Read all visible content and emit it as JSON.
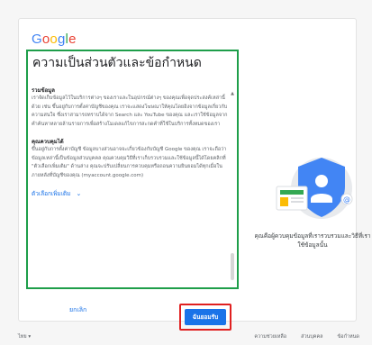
{
  "logo": {
    "letters": [
      "G",
      "o",
      "o",
      "g",
      "l",
      "e"
    ],
    "colors": [
      "#4285F4",
      "#EA4335",
      "#FBBC05",
      "#4285F4",
      "#34A853",
      "#EA4335"
    ]
  },
  "title": "ความเป็นส่วนตัวและข้อกำหนด",
  "sections": [
    {
      "heading": "รวมข้อมูล",
      "text": "เราจัดเก็บข้อมูลไว้ในบริการต่างๆ ของเราและในอุปกรณ์ต่างๆ ของคุณเพื่อจุดประสงค์เหล่านี้ด้วย เช่น ขึ้นอยู่กับการตั้งค่าบัญชีของคุณ เราจะแสดงโฆษณาให้คุณโดยอิงจากข้อมูลเกี่ยวกับความสนใจ ซึ่งเราสามารถทราบได้จาก Search และ YouTube ของคุณ และเราใช้ข้อมูลจากคำค้นหาหลายล้านรายการเพื่อสร้างโมเดลแก้ไขการสะกดคำที่ใช้ในบริการทั้งหมดของเรา"
    },
    {
      "heading": "คุณควบคุมได้",
      "text": "ขึ้นอยู่กับการตั้งค่าบัญชี ข้อมูลบางส่วนอาจจะเกี่ยวข้องกับบัญชี Google ของคุณ เราจะถือว่าข้อมูลเหล่านี้เป็นข้อมูลส่วนบุคคล คุณควบคุมวิธีที่เราเก็บรวบรวมและใช้ข้อมูลนี้ได้โดยคลิกที่ \"ตัวเลือกเพิ่มเติม\" ด้านล่าง คุณจะปรับเปลี่ยนการควบคุมหรือถอนความยินยอมได้ทุกเมื่อในภายหลังที่บัญชีของคุณ (myaccount.google.com)"
    }
  ],
  "more_options_label": "ตัวเลือกเพิ่มเติม",
  "more_options_chevron": "⌄",
  "cancel_label": "ยกเลิก",
  "agree_label": "ฉันยอมรับ",
  "caption": "คุณคือผู้ควบคุมข้อมูลที่เรารวบรวมและวิธีที่เราใช้ข้อมูลนั้น",
  "footer": {
    "language": "ไทย ▾",
    "links": [
      "ความช่วยเหลือ",
      "ส่วนบุคคล",
      "ข้อกำหนด"
    ]
  },
  "colors": {
    "accent": "#1a73e8",
    "green_highlight": "#1e9e4a",
    "red_highlight": "#e02020"
  }
}
